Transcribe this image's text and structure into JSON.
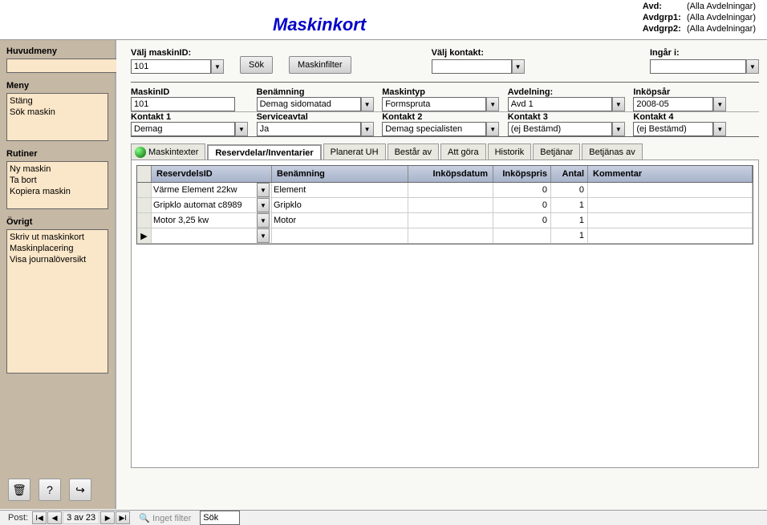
{
  "title": "Maskinkort",
  "dept": {
    "avd_lbl": "Avd:",
    "avd": "(Alla Avdelningar)",
    "g1_lbl": "Avdgrp1:",
    "g1": "(Alla Avdelningar)",
    "g2_lbl": "Avdgrp2:",
    "g2": "(Alla Avdelningar)"
  },
  "sidebar": {
    "huvud_lbl": "Huvudmeny",
    "meny_lbl": "Meny",
    "meny_items": {
      "a": "Stäng",
      "b": "Sök maskin"
    },
    "rutiner_lbl": "Rutiner",
    "rutiner_items": {
      "a": "Ny maskin",
      "b": "Ta bort",
      "c": "Kopiera maskin"
    },
    "ovrigt_lbl": "Övrigt",
    "ovrigt_items": {
      "a": "Skriv ut maskinkort",
      "b": "Maskinplacering",
      "c": "Visa journalöversikt"
    }
  },
  "filter": {
    "valj_maskin_lbl": "Välj maskinID:",
    "valj_maskin": "101",
    "sok_btn": "Sök",
    "maskinfilter_btn": "Maskinfilter",
    "valj_kontakt_lbl": "Välj kontakt:",
    "ingar_lbl": "Ingår i:"
  },
  "form": {
    "maskinid_lbl": "MaskinID",
    "maskinid": "101",
    "benamn_lbl": "Benämning",
    "benamn": "Demag sidomatad",
    "typ_lbl": "Maskintyp",
    "typ": "Formspruta",
    "avd_lbl": "Avdelning:",
    "avd": "Avd 1",
    "inkop_lbl": "Inköpsår",
    "inkop": "2008-05",
    "k1_lbl": "Kontakt 1",
    "k1": "Demag",
    "serv_lbl": "Serviceavtal",
    "serv": "Ja",
    "k2_lbl": "Kontakt 2",
    "k2": "Demag specialisten",
    "k3_lbl": "Kontakt 3",
    "k3": "(ej Bestämd)",
    "k4_lbl": "Kontakt 4",
    "k4": "(ej Bestämd)"
  },
  "tabs": {
    "t1": "Maskintexter",
    "t2": "Reservdelar/Inventarier",
    "t3": "Planerat UH",
    "t4": "Består av",
    "t5": "Att göra",
    "t6": "Historik",
    "t7": "Betjänar",
    "t8": "Betjänas av"
  },
  "table": {
    "headers": {
      "id": "ReservdelsID",
      "name": "Benämning",
      "date": "Inköpsdatum",
      "price": "Inköpspris",
      "qty": "Antal",
      "comment": "Kommentar"
    },
    "rows": [
      {
        "id": "Värme Element 22kw",
        "name": "Element",
        "date": "",
        "price": "0",
        "qty": "0",
        "comment": ""
      },
      {
        "id": "Gripklo automat c8989",
        "name": "Gripklo",
        "date": "",
        "price": "0",
        "qty": "1",
        "comment": ""
      },
      {
        "id": "Motor 3,25 kw",
        "name": "Motor",
        "date": "",
        "price": "0",
        "qty": "1",
        "comment": ""
      },
      {
        "id": "",
        "name": "",
        "date": "",
        "price": "",
        "qty": "1",
        "comment": ""
      }
    ]
  },
  "status": {
    "post_lbl": "Post:",
    "pos": "3 av 23",
    "nofilter": "Inget filter",
    "search": "Sök"
  }
}
